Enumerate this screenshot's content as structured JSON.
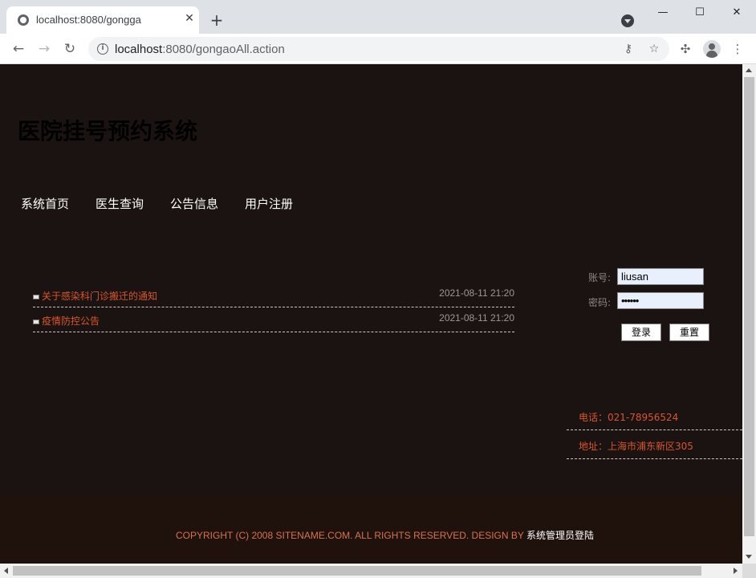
{
  "browser": {
    "tab_title": "localhost:8080/gongga",
    "tab_close": "✕",
    "new_tab": "+",
    "url_host": "localhost",
    "url_path": ":8080/gongaoAll.action",
    "window_minimize": "—",
    "window_maximize": "☐",
    "window_close": "✕",
    "back": "←",
    "forward": "→",
    "reload": "↻",
    "info": "i",
    "key_icon": "⚷",
    "star_icon": "☆",
    "puzzle_icon": "✣",
    "menu_icon": "⋮"
  },
  "site": {
    "title": "医院挂号预约系统",
    "nav": [
      "系统首页",
      "医生查询",
      "公告信息",
      "用户注册"
    ]
  },
  "announcements": [
    {
      "title": "关于感染科门诊搬迁的通知",
      "date": "2021-08-11 21:20"
    },
    {
      "title": "疫情防控公告",
      "date": "2021-08-11 21:20"
    }
  ],
  "login": {
    "account_label": "账号:",
    "account_value": "liusan",
    "password_label": "密码:",
    "password_value": "••••••",
    "login_button": "登录",
    "reset_button": "重置"
  },
  "contact": {
    "phone": "电话：021-78956524",
    "address": "地址：上海市浦东新区305"
  },
  "footer": {
    "copyright": "COPYRIGHT (C) 2008 SITENAME.COM. ALL RIGHTS RESERVED. DESIGN BY ",
    "admin_link": "系统管理员登陆"
  }
}
